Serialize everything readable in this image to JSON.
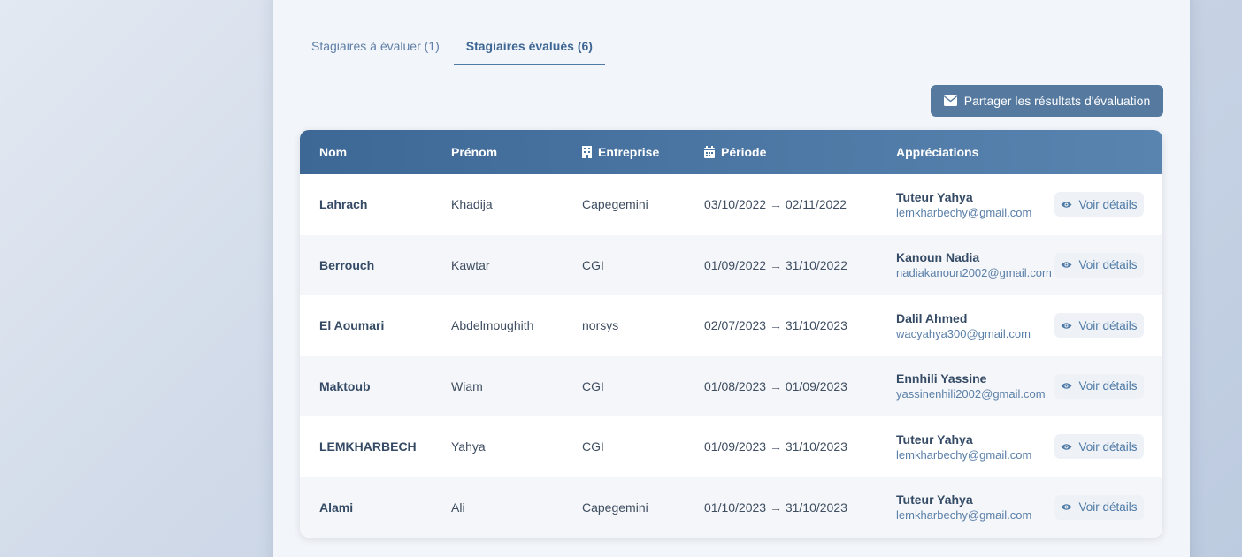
{
  "tabs": [
    {
      "label": "Stagiaires à évaluer (1)",
      "active": false
    },
    {
      "label": "Stagiaires évalués (6)",
      "active": true
    }
  ],
  "share_button": {
    "label": "Partager les résultats d'évaluation",
    "icon": "envelope-icon"
  },
  "table": {
    "headers": {
      "nom": "Nom",
      "prenom": "Prénom",
      "entreprise": "Entreprise",
      "periode": "Période",
      "appreciations": "Appréciations"
    },
    "action_label": "Voir détails",
    "rows": [
      {
        "nom": "Lahrach",
        "prenom": "Khadija",
        "entreprise": "Capegemini",
        "periode": "03/10/2022 → 02/11/2022",
        "tuteur": "Tuteur Yahya",
        "email": "lemkharbechy@gmail.com"
      },
      {
        "nom": "Berrouch",
        "prenom": "Kawtar",
        "entreprise": "CGI",
        "periode": "01/09/2022 → 31/10/2022",
        "tuteur": "Kanoun Nadia",
        "email": "nadiakanoun2002@gmail.com"
      },
      {
        "nom": "El Aoumari",
        "prenom": "Abdelmoughith",
        "entreprise": "norsys",
        "periode": "02/07/2023 → 31/10/2023",
        "tuteur": "Dalil Ahmed",
        "email": "wacyahya300@gmail.com"
      },
      {
        "nom": "Maktoub",
        "prenom": "Wiam",
        "entreprise": "CGI",
        "periode": "01/08/2023 → 01/09/2023",
        "tuteur": "Ennhili Yassine",
        "email": "yassinenhili2002@gmail.com"
      },
      {
        "nom": "LEMKHARBECH",
        "prenom": "Yahya",
        "entreprise": "CGI",
        "periode": "01/09/2023 → 31/10/2023",
        "tuteur": "Tuteur Yahya",
        "email": "lemkharbechy@gmail.com"
      },
      {
        "nom": "Alami",
        "prenom": "Ali",
        "entreprise": "Capegemini",
        "periode": "01/10/2023 → 31/10/2023",
        "tuteur": "Tuteur Yahya",
        "email": "lemkharbechy@gmail.com"
      }
    ]
  },
  "colors": {
    "header_start": "#3d6896",
    "header_end": "#5a84b0",
    "accent": "#55799f"
  }
}
